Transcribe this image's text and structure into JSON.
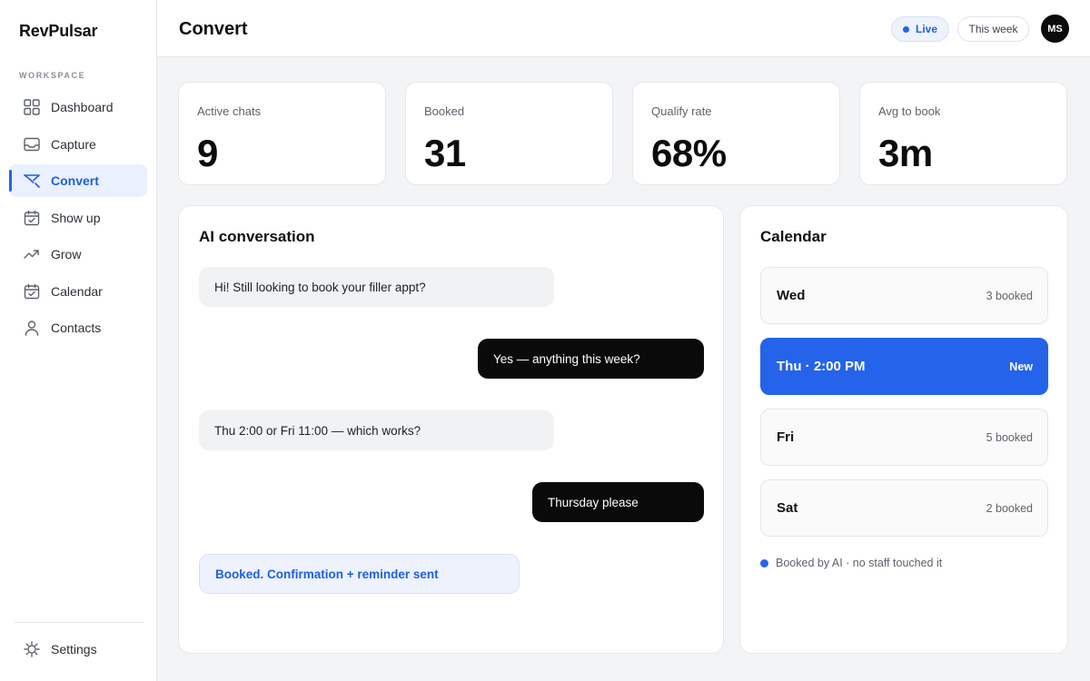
{
  "brand": "RevPulsar",
  "sidebar": {
    "section_label": "WORKSPACE",
    "items": [
      {
        "label": "Dashboard",
        "icon": "grid-icon"
      },
      {
        "label": "Capture",
        "icon": "inbox-icon"
      },
      {
        "label": "Convert",
        "icon": "funnel-icon",
        "active": true
      },
      {
        "label": "Show up",
        "icon": "calendar-check-icon"
      },
      {
        "label": "Grow",
        "icon": "trend-up-icon"
      },
      {
        "label": "Calendar",
        "icon": "calendar-icon"
      },
      {
        "label": "Contacts",
        "icon": "user-icon"
      }
    ],
    "settings_label": "Settings"
  },
  "header": {
    "title": "Convert",
    "live_label": "Live",
    "period_label": "This week",
    "avatar_initials": "MS"
  },
  "stats": [
    {
      "label": "Active chats",
      "value": "9"
    },
    {
      "label": "Booked",
      "value": "31"
    },
    {
      "label": "Qualify rate",
      "value": "68%"
    },
    {
      "label": "Avg to book",
      "value": "3m"
    }
  ],
  "conversation": {
    "title": "AI conversation",
    "messages": [
      {
        "from": "ai",
        "text": "Hi! Still looking to book your filler appt?"
      },
      {
        "from": "user",
        "text": "Yes — anything this week?"
      },
      {
        "from": "ai",
        "text": "Thu 2:00 or Fri 11:00 — which works?"
      },
      {
        "from": "user",
        "text": "Thursday please"
      }
    ],
    "confirmation": "Booked. Confirmation + reminder sent"
  },
  "calendar": {
    "title": "Calendar",
    "days": [
      {
        "name": "Wed",
        "status": "3 booked"
      },
      {
        "name": "Thu · 2:00 PM",
        "status": "New",
        "selected": true
      },
      {
        "name": "Fri",
        "status": "5 booked"
      },
      {
        "name": "Sat",
        "status": "2 booked"
      }
    ],
    "note": "Booked by AI · no staff touched it"
  },
  "colors": {
    "accent": "#2563eb",
    "accent_soft": "#eaf0fd",
    "user_bubble": "#0a0a0a",
    "ai_bubble": "#f1f2f4"
  }
}
